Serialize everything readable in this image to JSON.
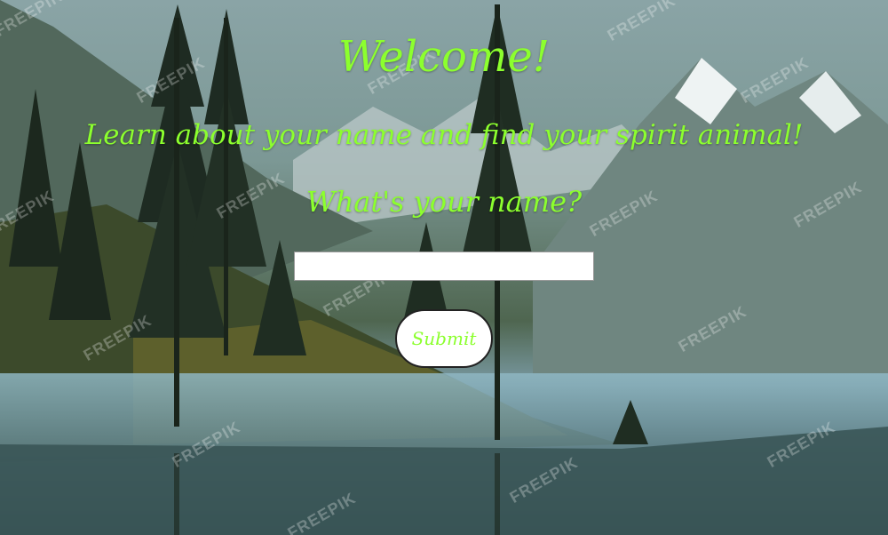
{
  "header": {
    "welcome": "Welcome!",
    "subtitle": "Learn about your name and find your spirit animal!"
  },
  "form": {
    "question": "What's your name?",
    "name_value": "",
    "submit_label": "Submit"
  },
  "watermark": {
    "text": "FREEPIK"
  },
  "colors": {
    "accent": "#8cff2e",
    "button_bg": "#ffffff",
    "input_bg": "#ffffff"
  }
}
